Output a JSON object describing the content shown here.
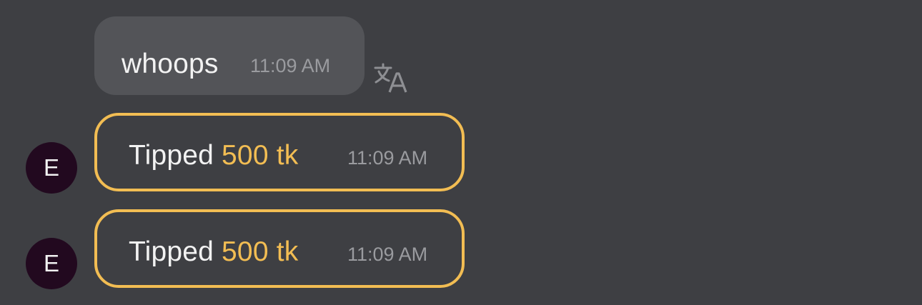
{
  "messages": [
    {
      "text": "whoops",
      "time": "11:09 AM",
      "translate_icon": "translate-icon"
    }
  ],
  "tips": [
    {
      "avatar_initial": "E",
      "label": "Tipped",
      "amount": "500 tk",
      "time": "11:09 AM"
    },
    {
      "avatar_initial": "E",
      "label": "Tipped",
      "amount": "500 tk",
      "time": "11:09 AM"
    }
  ],
  "colors": {
    "background": "#3e3f43",
    "message_bubble": "#535458",
    "tip_accent": "#f2bd53",
    "avatar_bg": "#22091f",
    "timestamp": "#9a9b9f"
  }
}
